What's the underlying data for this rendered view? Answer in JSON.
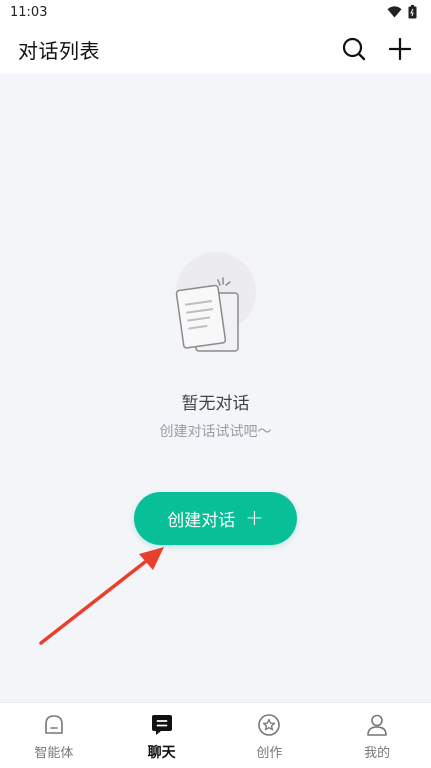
{
  "status_bar": {
    "time": "11:03",
    "icons": [
      "wifi-icon",
      "battery-icon"
    ]
  },
  "header": {
    "title": "对话列表",
    "actions": [
      "search-icon",
      "plus-icon"
    ]
  },
  "empty_state": {
    "title": "暂无对话",
    "subtitle": "创建对话试试吧～",
    "illustration": "documents-icon"
  },
  "create_button": {
    "label": "创建对话",
    "icon": "plus-icon"
  },
  "annotation": {
    "type": "arrow",
    "color": "#e8402c"
  },
  "tab_bar": {
    "active_index": 1,
    "tabs": [
      {
        "label": "智能体",
        "icon": "agent-icon"
      },
      {
        "label": "聊天",
        "icon": "chat-icon"
      },
      {
        "label": "创作",
        "icon": "create-star-icon"
      },
      {
        "label": "我的",
        "icon": "profile-icon"
      }
    ]
  },
  "colors": {
    "accent": "#08bf97",
    "background": "#f4f5f9",
    "annotation": "#e8402c"
  }
}
